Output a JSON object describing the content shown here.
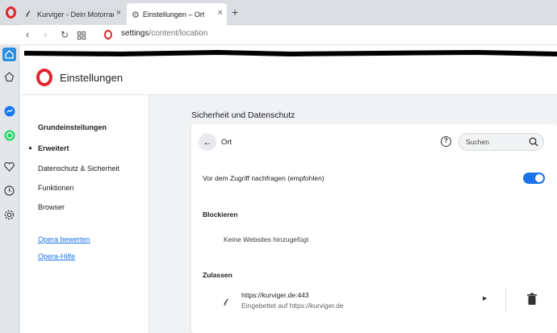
{
  "tabs": [
    {
      "title": "Kurviger - Dein Motorrad-Rou",
      "icon": "motorcycle-favicon-icon"
    },
    {
      "title": "Einstellungen – Ort",
      "icon": "gear-icon"
    }
  ],
  "address_bar": {
    "url_host": "settings",
    "url_path": "/content/location"
  },
  "sidebar": {
    "icons": [
      "home-icon",
      "speed-dial-icon",
      "messenger-icon",
      "whatsapp-icon",
      "heart-icon",
      "history-icon",
      "settings-icon"
    ]
  },
  "header": {
    "title": "Einstellungen"
  },
  "nav": {
    "basic": "Grundeinstellungen",
    "advanced": "Erweitert",
    "privacy": "Datenschutz & Sicherheit",
    "features": "Funktionen",
    "browser": "Browser",
    "rate": "Opera bewerten",
    "help": "Opera-Hilfe"
  },
  "section": {
    "title": "Sicherheit und Datenschutz"
  },
  "card": {
    "title": "Ort",
    "search_placeholder": "Suchen",
    "ask_label": "Vor dem Zugriff nachfragen (empfohlen)",
    "ask_enabled": true,
    "block_title": "Blockieren",
    "block_empty": "Keine Websites hinzugefügt",
    "allow_title": "Zulassen",
    "allowed_sites": [
      {
        "url": "https://kurviger.de:443",
        "embedded": "Eingebettet auf https://kurviger.de"
      }
    ]
  },
  "colors": {
    "accent": "#1a73e8",
    "opera_red": "#e0262c"
  }
}
